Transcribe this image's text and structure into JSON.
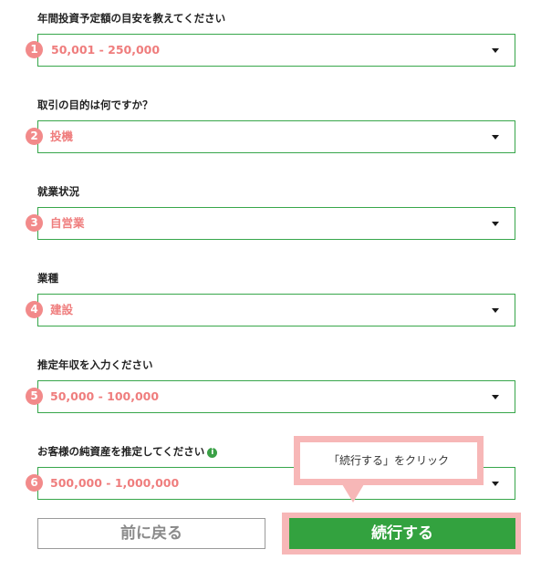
{
  "fields": [
    {
      "step": "1",
      "label": "年間投資予定額の目安を教えてください",
      "value": "50,001 - 250,000"
    },
    {
      "step": "2",
      "label": "取引の目的は何ですか？",
      "value": "投機"
    },
    {
      "step": "3",
      "label": "就業状況",
      "value": "自営業"
    },
    {
      "step": "4",
      "label": "業種",
      "value": "建設"
    },
    {
      "step": "5",
      "label": "推定年収を入力ください",
      "value": "50,000 - 100,000"
    },
    {
      "step": "6",
      "label": "お客様の純資産を推定してください",
      "value": "500,000 - 1,000,000",
      "info_icon": "i"
    }
  ],
  "buttons": {
    "back_label": "前に戻る",
    "continue_label": "続行する"
  },
  "callout": {
    "text": "「続行する」をクリック"
  },
  "colors": {
    "accent_green": "#33a23f",
    "field_border": "#37a64a",
    "value_text": "#ef7d7d",
    "badge": "#f28a8a",
    "highlight": "#f7b7b7"
  },
  "icons": {
    "dropdown": "caret-down-icon",
    "info": "info-icon"
  }
}
